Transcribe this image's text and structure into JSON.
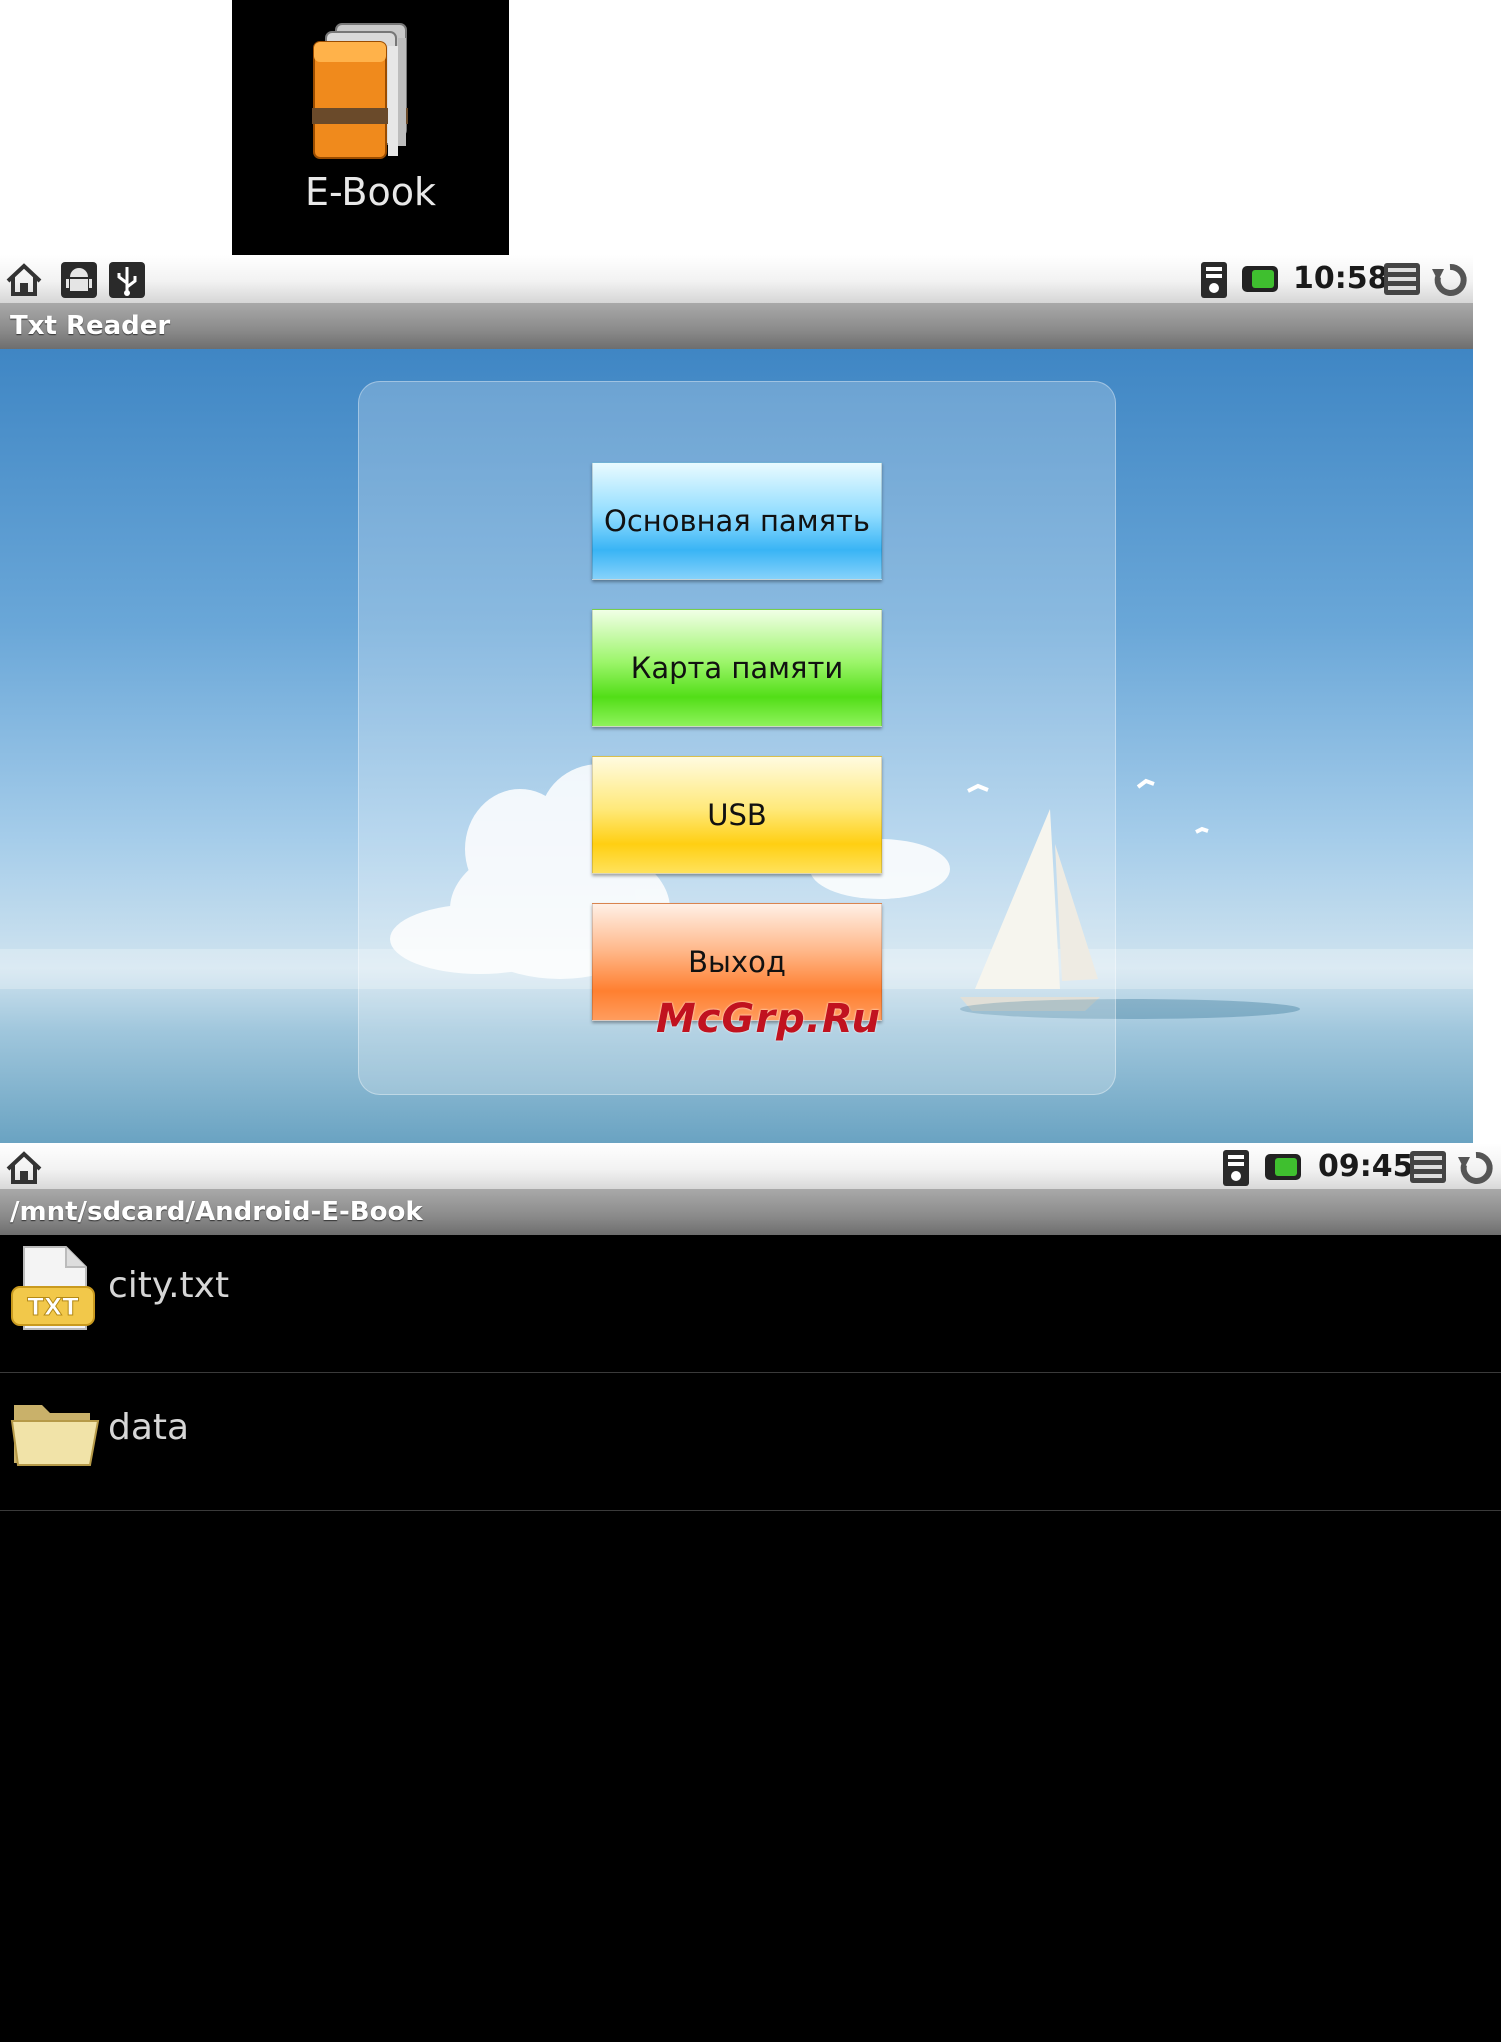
{
  "launcher": {
    "label": "E-Book"
  },
  "reader_screen": {
    "status": {
      "time": "10:58"
    },
    "title": "Txt Reader",
    "buttons": {
      "internal": "Основная память",
      "card": "Карта памяти",
      "usb": "USB",
      "exit": "Выход"
    },
    "watermark": "McGrp.Ru"
  },
  "browser_screen": {
    "status": {
      "time": "09:45"
    },
    "path": "/mnt/sdcard/Android-E-Book",
    "files": [
      {
        "name": "city.txt",
        "icon": "txt-file-icon"
      },
      {
        "name": "data",
        "icon": "folder-icon"
      }
    ]
  },
  "colors": {
    "internal_button": "#39b4f5",
    "card_button": "#52de17",
    "usb_button": "#ffcf12",
    "exit_button": "#ff7f30",
    "watermark": "#c1121f"
  }
}
